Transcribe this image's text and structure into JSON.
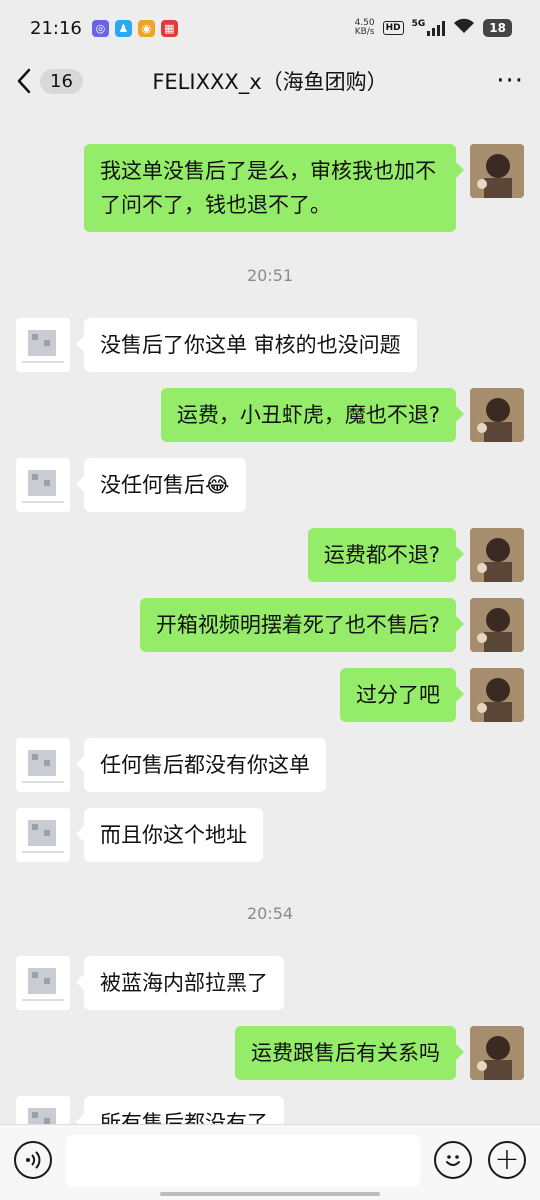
{
  "status_bar": {
    "time": "21:16",
    "net_speed": "4.50\nKB/s",
    "hd": "HD",
    "network": "5G",
    "battery": "18",
    "left_icons": [
      "soul-icon",
      "qq-icon",
      "weibo-icon",
      "app-icon"
    ]
  },
  "header": {
    "unread_count": "16",
    "title": "FELIXXX_x（海鱼团购）",
    "more": "···"
  },
  "messages": [
    {
      "side": "right",
      "text": "我这单没售后了是么，审核我也加不了问不了，钱也退不了。"
    },
    {
      "timestamp": "20:51"
    },
    {
      "side": "left",
      "text": "没售后了你这单 审核的也没问题"
    },
    {
      "side": "right",
      "text": "运费，小丑虾虎，魔也不退?"
    },
    {
      "side": "left",
      "text": "没任何售后",
      "emoji": "😂"
    },
    {
      "side": "right",
      "text": "运费都不退?"
    },
    {
      "side": "right",
      "text": "开箱视频明摆着死了也不售后?"
    },
    {
      "side": "right",
      "text": "过分了吧"
    },
    {
      "side": "left",
      "text": "任何售后都没有你这单"
    },
    {
      "side": "left",
      "text": "而且你这个地址"
    },
    {
      "timestamp": "20:54"
    },
    {
      "side": "left",
      "text": "被蓝海内部拉黑了"
    },
    {
      "side": "right",
      "text": "运费跟售后有关系吗"
    },
    {
      "side": "left",
      "text": "所有售后都没有了"
    }
  ],
  "input_bar": {
    "placeholder": "",
    "plus": "+"
  },
  "colors": {
    "background": "#ededed",
    "my_bubble": "#95ec69",
    "their_bubble": "#ffffff"
  }
}
